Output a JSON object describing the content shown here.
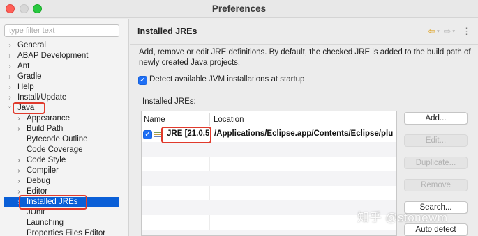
{
  "window": {
    "title": "Preferences"
  },
  "sidebar": {
    "filter_placeholder": "type filter text",
    "items": [
      {
        "label": "General",
        "chevron": "›"
      },
      {
        "label": "ABAP Development",
        "chevron": "›"
      },
      {
        "label": "Ant",
        "chevron": "›"
      },
      {
        "label": "Gradle",
        "chevron": "›"
      },
      {
        "label": "Help",
        "chevron": "›"
      },
      {
        "label": "Install/Update",
        "chevron": "›"
      },
      {
        "label": "Java",
        "chevron": "⌄"
      },
      {
        "label": "Appearance",
        "chevron": "›"
      },
      {
        "label": "Build Path",
        "chevron": "›"
      },
      {
        "label": "Bytecode Outline",
        "chevron": ""
      },
      {
        "label": "Code Coverage",
        "chevron": ""
      },
      {
        "label": "Code Style",
        "chevron": "›"
      },
      {
        "label": "Compiler",
        "chevron": "›"
      },
      {
        "label": "Debug",
        "chevron": "›"
      },
      {
        "label": "Editor",
        "chevron": "›"
      },
      {
        "label": "Installed JREs",
        "chevron": "›"
      },
      {
        "label": "JUnit",
        "chevron": ""
      },
      {
        "label": "Launching",
        "chevron": ""
      },
      {
        "label": "Properties Files Editor",
        "chevron": ""
      }
    ]
  },
  "page": {
    "title": "Installed JREs",
    "nav": {
      "back": "⇦",
      "forward": "⇨",
      "dropdown": "▾",
      "menu": "⋮"
    },
    "description": "Add, remove or edit JRE definitions. By default, the checked JRE is added to the build path of newly created Java projects.",
    "detect_label": "Detect available JVM installations at startup",
    "detect_checked": true,
    "table_label": "Installed JREs:",
    "columns": {
      "name": "Name",
      "location": "Location"
    },
    "rows": [
      {
        "name": "JRE [21.0.5",
        "location": "/Applications/Eclipse.app/Contents/Eclipse/plu",
        "checked": true
      }
    ],
    "buttons": {
      "add": "Add...",
      "edit": "Edit...",
      "duplicate": "Duplicate...",
      "remove": "Remove",
      "search": "Search...",
      "auto_detect": "Auto detect"
    }
  },
  "watermark": "知乎 @stonewm",
  "colors": {
    "selection": "#0a5fd7",
    "annotation": "#e03a2c",
    "checkbox": "#1e6ff5"
  }
}
